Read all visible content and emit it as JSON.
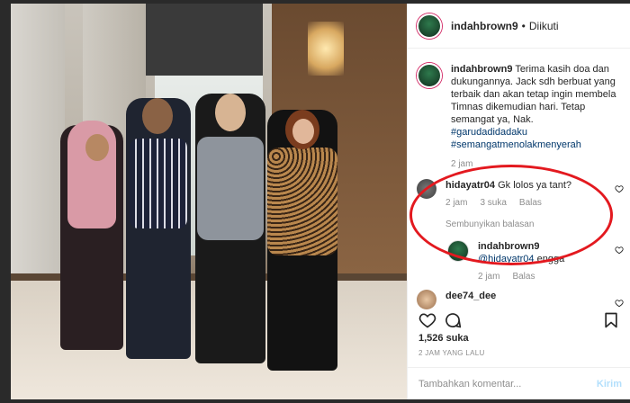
{
  "post": {
    "author": "indahbrown9",
    "follow_status": "Diikuti",
    "caption_author": "indahbrown9",
    "caption_text": "Terima kasih doa dan dukungannya. Jack sdh berbuat yang terbaik dan akan tetap ingin membela Timnas dikemudian hari. Tetap semangat ya, Nak.",
    "hashtags": [
      "#garudadidadaku",
      "#semangatmenolakmenyerah"
    ],
    "caption_time": "2 jam",
    "likes": "1,526 suka",
    "posted_ago": "2 JAM YANG LALU"
  },
  "comments": [
    {
      "username": "hidayatr04",
      "text": "Gk lolos ya tant?",
      "time": "2 jam",
      "likes": "3 suka",
      "reply_label": "Balas",
      "hide_replies": "Sembunyikan balasan"
    }
  ],
  "reply": {
    "username": "indahbrown9",
    "mention": "@hidayatr04",
    "text": "engga",
    "time": "2 jam",
    "reply_label": "Balas"
  },
  "next_comment": {
    "username": "dee74_dee"
  },
  "add_comment": {
    "placeholder": "Tambahkan komentar...",
    "post_label": "Kirim"
  },
  "icons": [
    "heart-icon",
    "comment-icon",
    "bookmark-icon",
    "more-icon"
  ],
  "colors": {
    "annotation": "#e3191f",
    "link": "#00376b",
    "post_button": "#b2dffc"
  }
}
